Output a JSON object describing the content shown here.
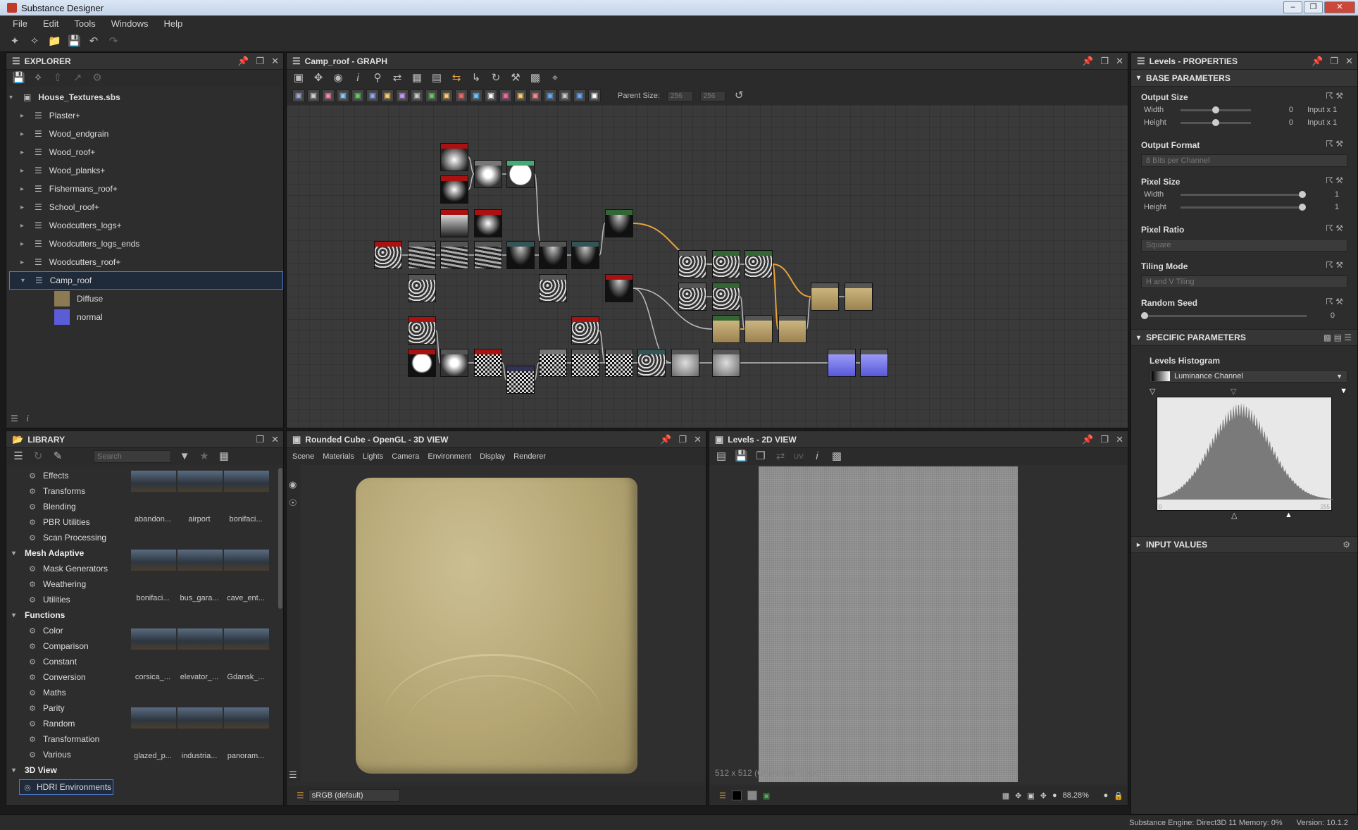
{
  "window": {
    "title": "Substance Designer"
  },
  "menu": [
    "File",
    "Edit",
    "Tools",
    "Windows",
    "Help"
  ],
  "explorer": {
    "title": "EXPLORER",
    "package": "House_Textures.sbs",
    "graphs": [
      "Plaster+",
      "Wood_endgrain",
      "Wood_roof+",
      "Wood_planks+",
      "Fishermans_roof+",
      "School_roof+",
      "Woodcutters_logs+",
      "Woodcutters_logs_ends",
      "Woodcutters_roof+"
    ],
    "selected_graph": "Camp_roof",
    "outputs": [
      {
        "label": "Diffuse",
        "color": "#8c7a55"
      },
      {
        "label": "normal",
        "color": "#5c5cd6"
      }
    ]
  },
  "graph": {
    "title": "Camp_roof - GRAPH",
    "parent_size_label": "Parent Size:",
    "parent_size_value": "256",
    "size_value2": "256"
  },
  "properties": {
    "title": "Levels - PROPERTIES",
    "base_section": "BASE PARAMETERS",
    "output_size": {
      "label": "Output Size",
      "width_label": "Width",
      "width_value": "0",
      "width_unit": "Input x 1",
      "height_label": "Height",
      "height_value": "0",
      "height_unit": "Input x 1"
    },
    "output_format": {
      "label": "Output Format",
      "value": "8 Bits per Channel"
    },
    "pixel_size": {
      "label": "Pixel Size",
      "width_label": "Width",
      "width_value": "1",
      "height_label": "Height",
      "height_value": "1"
    },
    "pixel_ratio": {
      "label": "Pixel Ratio",
      "value": "Square"
    },
    "tiling_mode": {
      "label": "Tiling Mode",
      "value": "H and V Tiling"
    },
    "random_seed": {
      "label": "Random Seed",
      "value": "0"
    },
    "specific_section": "SPECIFIC PARAMETERS",
    "histogram_label": "Levels Histogram",
    "histogram_channel": "Luminance Channel",
    "histogram_min": "0",
    "histogram_max": "255",
    "input_values_section": "INPUT VALUES"
  },
  "library": {
    "title": "LIBRARY",
    "search_placeholder": "Search",
    "categories": [
      {
        "label": "Effects",
        "head": false
      },
      {
        "label": "Transforms",
        "head": false
      },
      {
        "label": "Blending",
        "head": false
      },
      {
        "label": "PBR Utilities",
        "head": false
      },
      {
        "label": "Scan Processing",
        "head": false
      },
      {
        "label": "Mesh Adaptive",
        "head": true
      },
      {
        "label": "Mask Generators",
        "head": false
      },
      {
        "label": "Weathering",
        "head": false
      },
      {
        "label": "Utilities",
        "head": false
      },
      {
        "label": "Functions",
        "head": true
      },
      {
        "label": "Color",
        "head": false
      },
      {
        "label": "Comparison",
        "head": false
      },
      {
        "label": "Constant",
        "head": false
      },
      {
        "label": "Conversion",
        "head": false
      },
      {
        "label": "Maths",
        "head": false
      },
      {
        "label": "Parity",
        "head": false
      },
      {
        "label": "Random",
        "head": false
      },
      {
        "label": "Transformation",
        "head": false
      },
      {
        "label": "Various",
        "head": false
      },
      {
        "label": "3D View",
        "head": true
      }
    ],
    "selected_category": "HDRI Environments",
    "thumbnails": [
      [
        "abandon...",
        "airport",
        "bonifaci..."
      ],
      [
        "bonifaci...",
        "bus_gara...",
        "cave_ent..."
      ],
      [
        "corsica_...",
        "elevator_...",
        "Gdansk_..."
      ],
      [
        "glazed_p...",
        "industria...",
        "panoram..."
      ]
    ]
  },
  "view3d": {
    "title": "Rounded Cube - OpenGL - 3D VIEW",
    "menu": [
      "Scene",
      "Materials",
      "Lights",
      "Camera",
      "Environment",
      "Display",
      "Renderer"
    ],
    "colorspace": "sRGB (default)"
  },
  "view2d": {
    "title": "Levels - 2D VIEW",
    "info": "512 x 512 (Grayscale, 8bpc)",
    "zoom": "88.28%",
    "uv_label": "UV"
  },
  "statusbar": {
    "engine": "Substance Engine: Direct3D 11  Memory: 0%",
    "version": "Version: 10.1.2"
  }
}
